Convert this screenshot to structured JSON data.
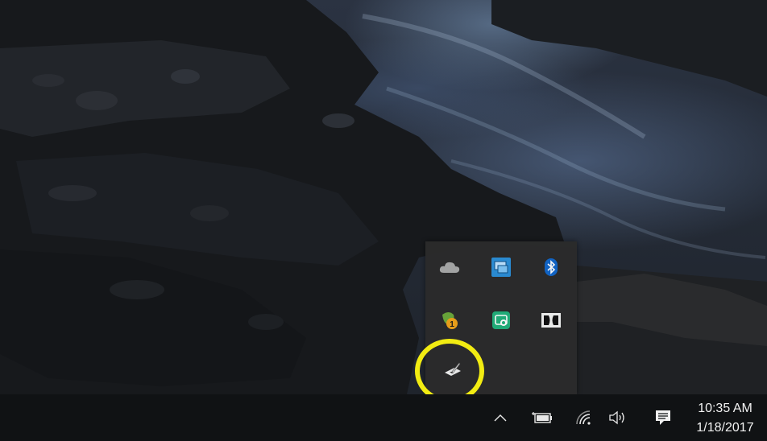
{
  "taskbar": {
    "time": "10:35 AM",
    "date": "1/18/2017",
    "icons": {
      "show_hidden": "chevron-up-icon",
      "power": "battery-icon",
      "network": "wifi-icon",
      "volume": "speaker-icon",
      "action_center": "notification-icon"
    }
  },
  "tray_flyout": {
    "items": [
      {
        "icon": "onedrive-cloud-icon"
      },
      {
        "icon": "display-settings-icon"
      },
      {
        "icon": "bluetooth-icon"
      },
      {
        "icon": "app-badge-icon",
        "badge": "1"
      },
      {
        "icon": "app-green-icon"
      },
      {
        "icon": "dolby-icon"
      },
      {
        "icon": "pen-tablet-icon"
      }
    ]
  },
  "colors": {
    "highlight_ring": "#f2ec12",
    "flyout_bg": "#2b2b2b",
    "taskbar_bg": "#101214"
  }
}
